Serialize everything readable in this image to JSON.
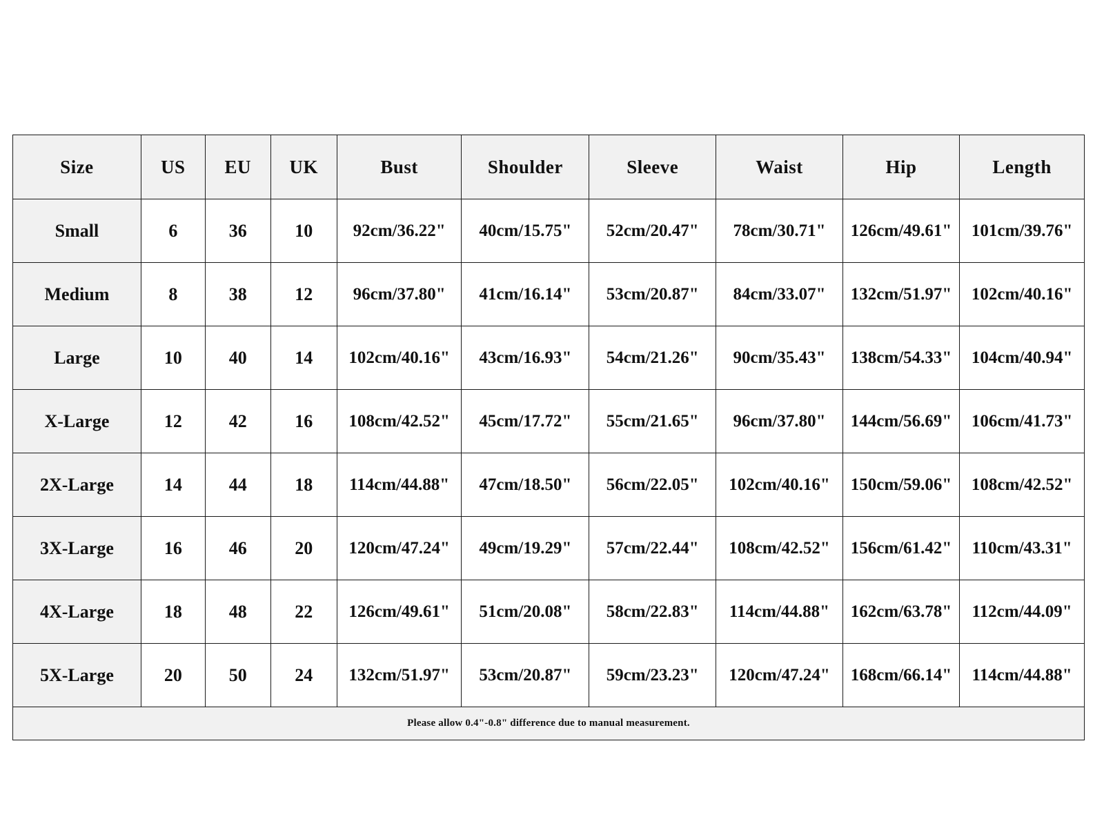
{
  "table": {
    "columns": [
      {
        "key": "size",
        "label": "Size"
      },
      {
        "key": "us",
        "label": "US"
      },
      {
        "key": "eu",
        "label": "EU"
      },
      {
        "key": "uk",
        "label": "UK"
      },
      {
        "key": "bust",
        "label": "Bust"
      },
      {
        "key": "shoulder",
        "label": "Shoulder"
      },
      {
        "key": "sleeve",
        "label": "Sleeve"
      },
      {
        "key": "waist",
        "label": "Waist"
      },
      {
        "key": "hip",
        "label": "Hip"
      },
      {
        "key": "length",
        "label": "Length"
      }
    ],
    "rows": [
      {
        "size": "Small",
        "us": "6",
        "eu": "36",
        "uk": "10",
        "bust": "92cm/36.22\"",
        "shoulder": "40cm/15.75\"",
        "sleeve": "52cm/20.47\"",
        "waist": "78cm/30.71\"",
        "hip": "126cm/49.61\"",
        "length": "101cm/39.76\""
      },
      {
        "size": "Medium",
        "us": "8",
        "eu": "38",
        "uk": "12",
        "bust": "96cm/37.80\"",
        "shoulder": "41cm/16.14\"",
        "sleeve": "53cm/20.87\"",
        "waist": "84cm/33.07\"",
        "hip": "132cm/51.97\"",
        "length": "102cm/40.16\""
      },
      {
        "size": "Large",
        "us": "10",
        "eu": "40",
        "uk": "14",
        "bust": "102cm/40.16\"",
        "shoulder": "43cm/16.93\"",
        "sleeve": "54cm/21.26\"",
        "waist": "90cm/35.43\"",
        "hip": "138cm/54.33\"",
        "length": "104cm/40.94\""
      },
      {
        "size": "X-Large",
        "us": "12",
        "eu": "42",
        "uk": "16",
        "bust": "108cm/42.52\"",
        "shoulder": "45cm/17.72\"",
        "sleeve": "55cm/21.65\"",
        "waist": "96cm/37.80\"",
        "hip": "144cm/56.69\"",
        "length": "106cm/41.73\""
      },
      {
        "size": "2X-Large",
        "us": "14",
        "eu": "44",
        "uk": "18",
        "bust": "114cm/44.88\"",
        "shoulder": "47cm/18.50\"",
        "sleeve": "56cm/22.05\"",
        "waist": "102cm/40.16\"",
        "hip": "150cm/59.06\"",
        "length": "108cm/42.52\""
      },
      {
        "size": "3X-Large",
        "us": "16",
        "eu": "46",
        "uk": "20",
        "bust": "120cm/47.24\"",
        "shoulder": "49cm/19.29\"",
        "sleeve": "57cm/22.44\"",
        "waist": "108cm/42.52\"",
        "hip": "156cm/61.42\"",
        "length": "110cm/43.31\""
      },
      {
        "size": "4X-Large",
        "us": "18",
        "eu": "48",
        "uk": "22",
        "bust": "126cm/49.61\"",
        "shoulder": "51cm/20.08\"",
        "sleeve": "58cm/22.83\"",
        "waist": "114cm/44.88\"",
        "hip": "162cm/63.78\"",
        "length": "112cm/44.09\""
      },
      {
        "size": "5X-Large",
        "us": "20",
        "eu": "50",
        "uk": "24",
        "bust": "132cm/51.97\"",
        "shoulder": "53cm/20.87\"",
        "sleeve": "59cm/23.23\"",
        "waist": "120cm/47.24\"",
        "hip": "168cm/66.14\"",
        "length": "114cm/44.88\""
      }
    ],
    "footer_note": "Please allow 0.4\"-0.8\" difference due to manual measurement."
  },
  "colors": {
    "header_fill": "#f1f1f1",
    "cell_fill": "#ffffff",
    "border": "#1a1a1a",
    "text": "#111111",
    "page_background": "#ffffff"
  }
}
